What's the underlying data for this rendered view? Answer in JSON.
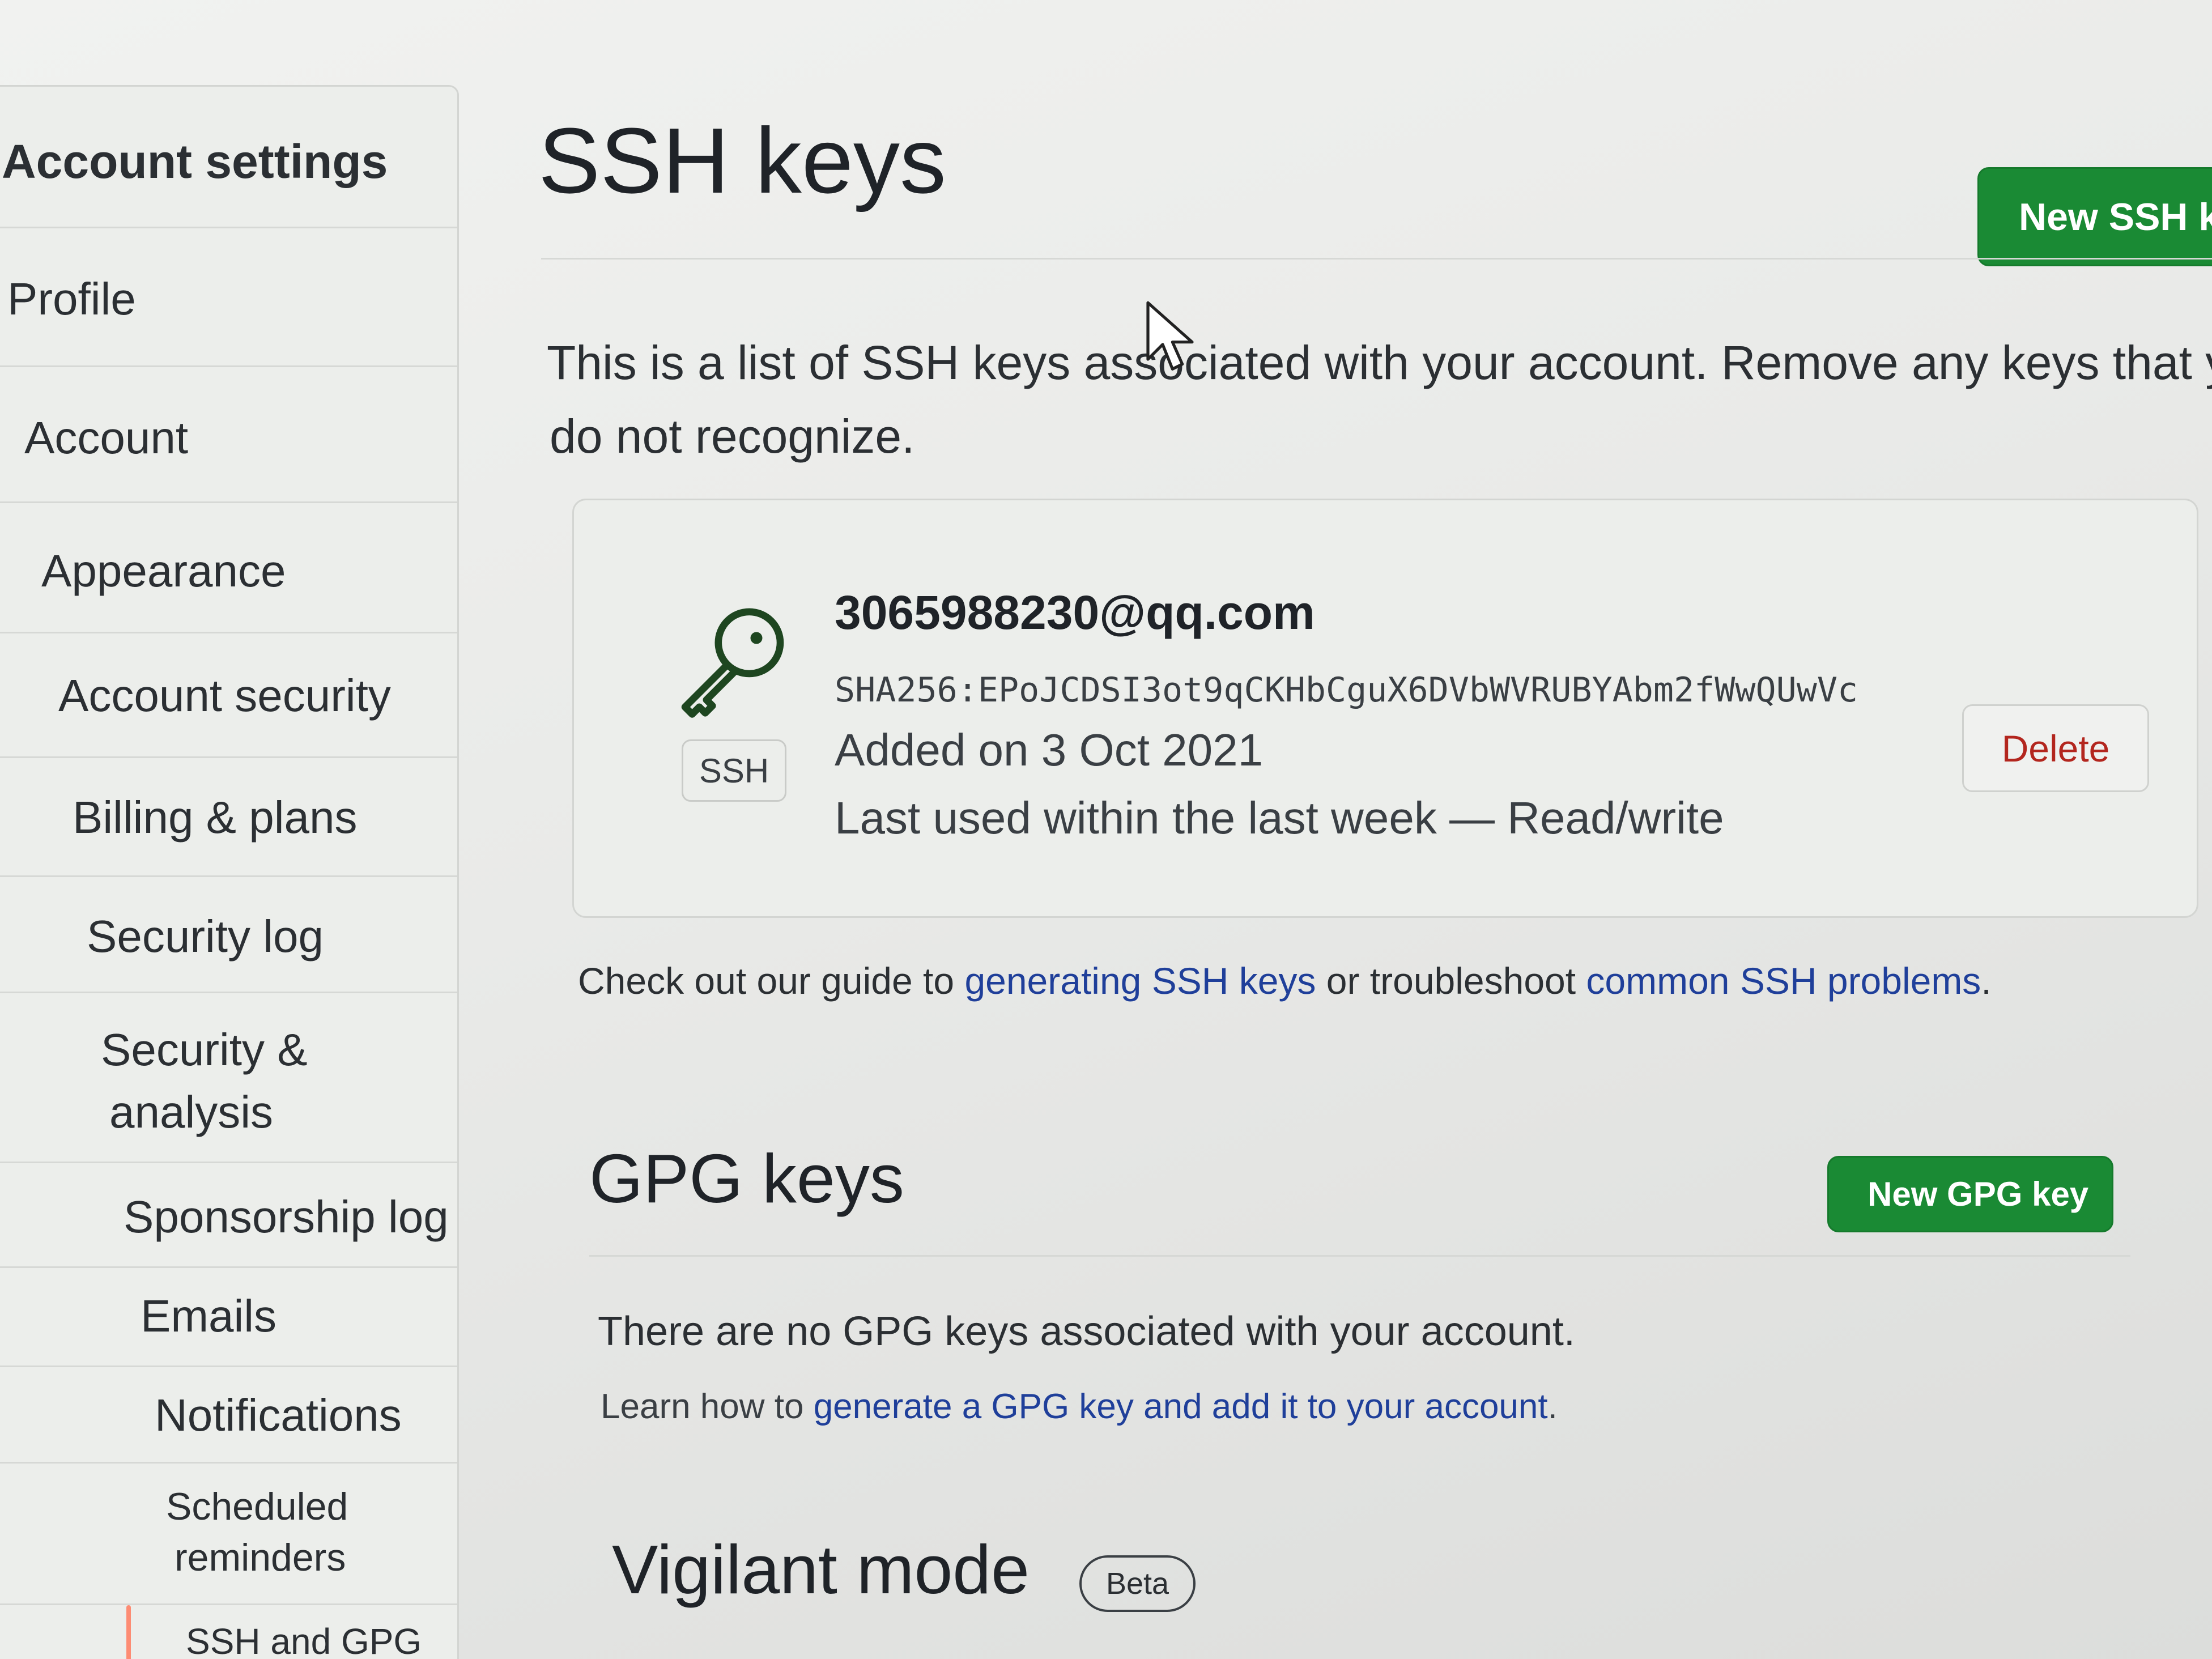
{
  "sidebar": {
    "items": [
      {
        "label": "Account settings"
      },
      {
        "label": "Profile"
      },
      {
        "label": "Account"
      },
      {
        "label": "Appearance"
      },
      {
        "label": "Account security"
      },
      {
        "label": "Billing & plans"
      },
      {
        "label": "Security log"
      },
      {
        "label": "Security &",
        "label2": "analysis"
      },
      {
        "label": "Sponsorship log"
      },
      {
        "label": "Emails"
      },
      {
        "label": "Notifications"
      },
      {
        "label": "Scheduled",
        "label2": "reminders"
      },
      {
        "label": "SSH and GPG"
      }
    ]
  },
  "ssh": {
    "title": "SSH keys",
    "new_button": "New SSH k",
    "description_line1": "This is a list of SSH keys associated with your account. Remove any keys that you",
    "description_line2": "do not recognize.",
    "key": {
      "title": "3065988230@qq.com",
      "fingerprint": "SHA256:EPoJCDSI3ot9qCKHbCguX6DVbWVRUBYAbm2fWwQUwVc",
      "added": "Added on 3 Oct 2021",
      "last_used": "Last used within the last week — Read/write",
      "badge": "SSH",
      "delete_label": "Delete"
    },
    "guide_prefix": "Check out our guide to ",
    "guide_link1": "generating SSH keys",
    "guide_middle": " or troubleshoot ",
    "guide_link2": "common SSH problems",
    "guide_suffix": "."
  },
  "gpg": {
    "title": "GPG keys",
    "new_button": "New GPG key",
    "empty_text": "There are no GPG keys associated with your account.",
    "learn_prefix": "Learn how to ",
    "learn_link": "generate a GPG key and add it to your account",
    "learn_suffix": "."
  },
  "vigilant": {
    "title": "Vigilant mode",
    "badge": "Beta"
  },
  "colors": {
    "primary_button": "#1a8a34",
    "link": "#1f3f9a",
    "danger": "#b3261e"
  }
}
